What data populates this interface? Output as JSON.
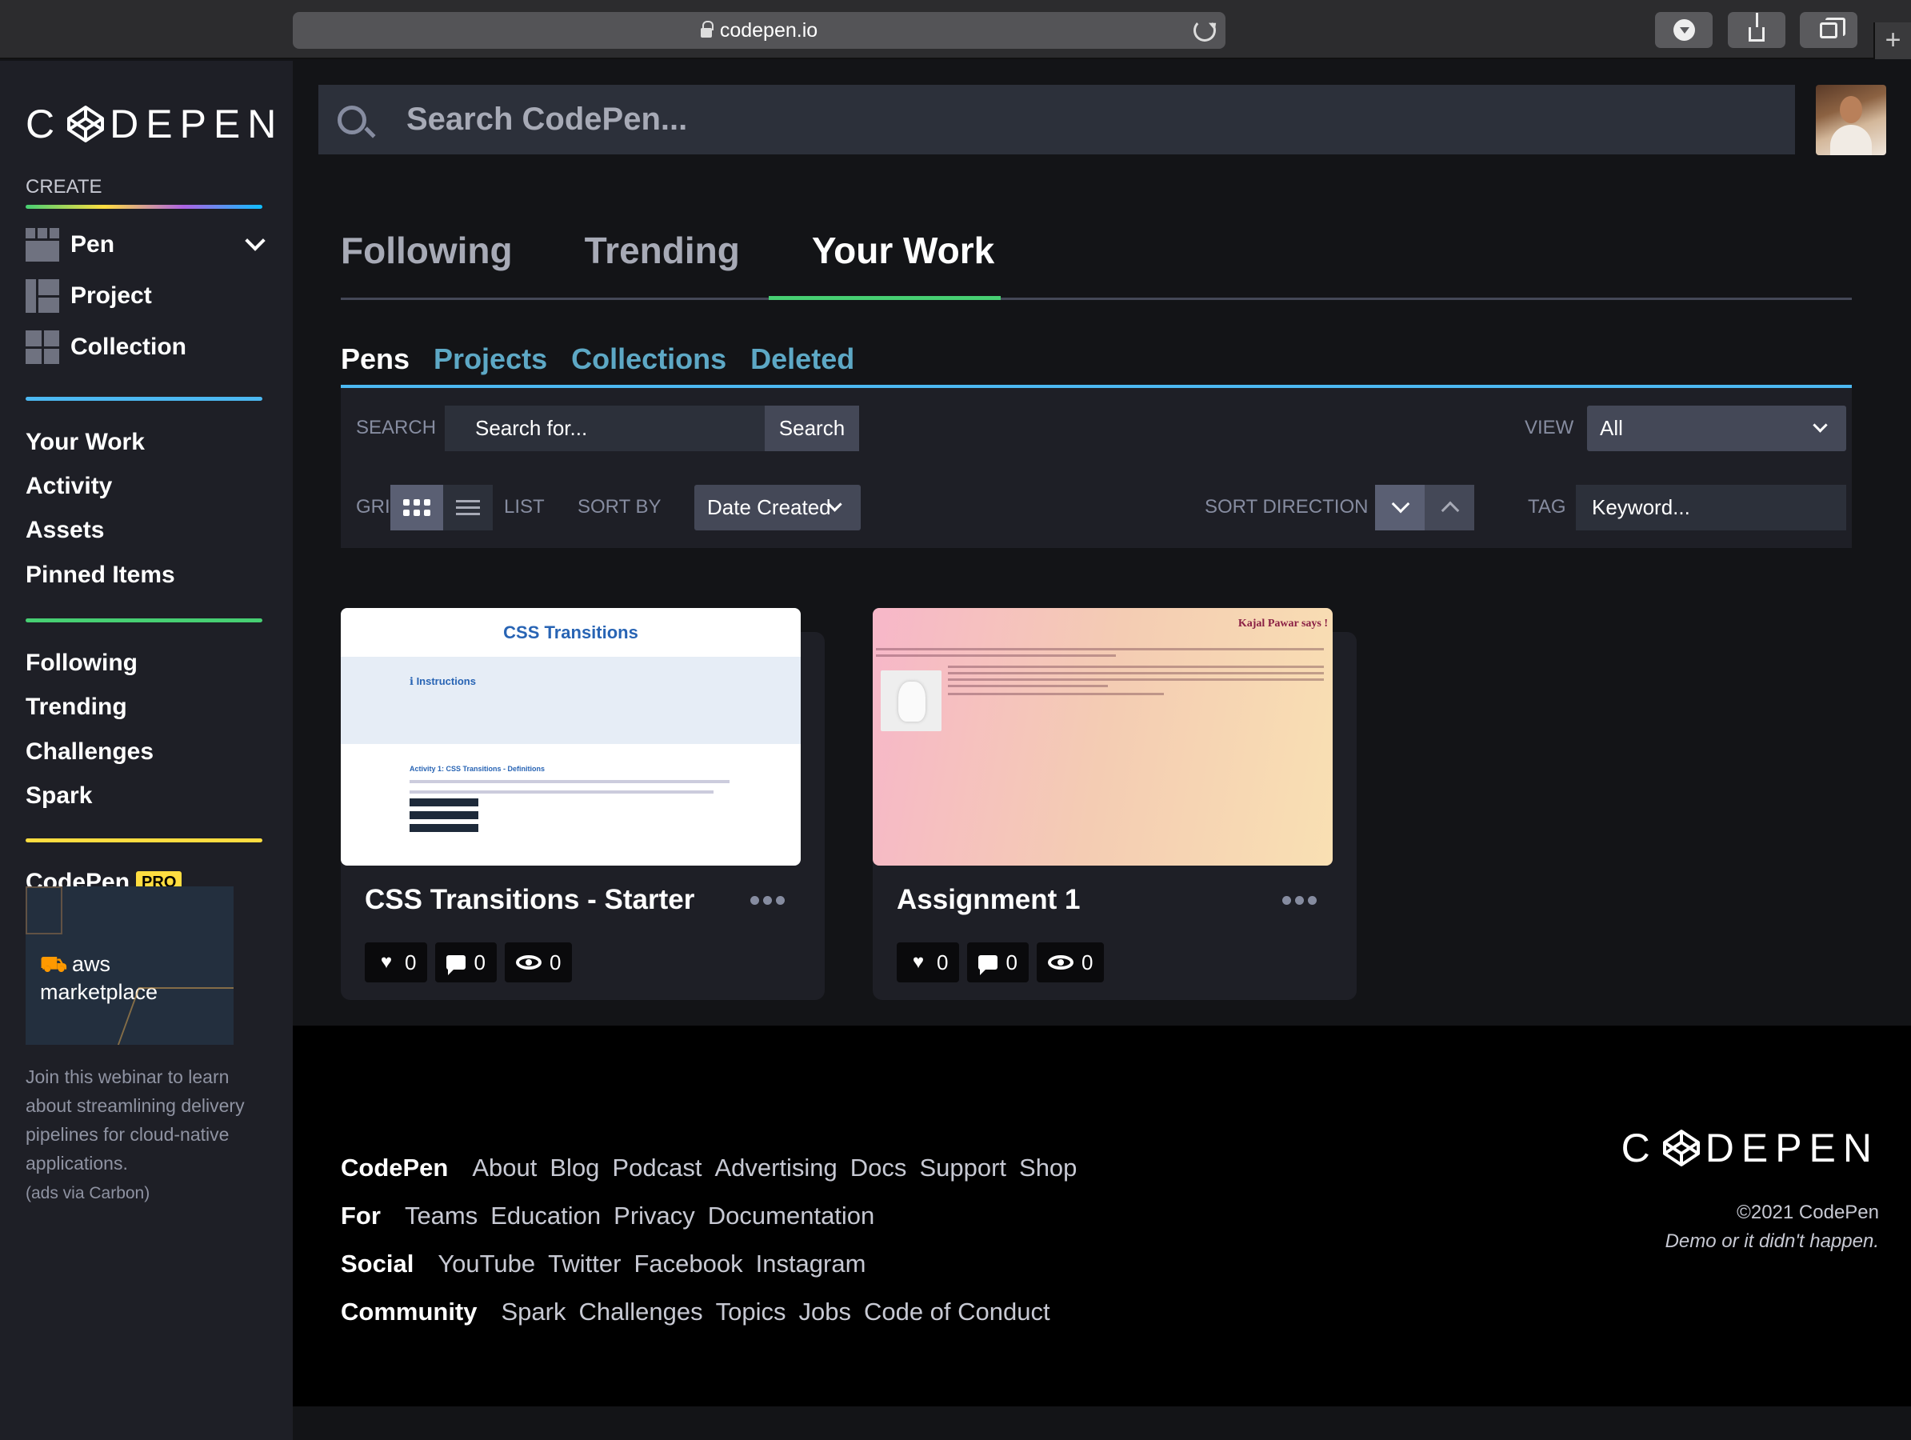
{
  "browser": {
    "url": "codepen.io"
  },
  "sidebar": {
    "logo": "CODEPEN",
    "create_label": "CREATE",
    "create_items": [
      {
        "label": "Pen"
      },
      {
        "label": "Project"
      },
      {
        "label": "Collection"
      }
    ],
    "nav_group1": [
      "Your Work",
      "Activity",
      "Assets",
      "Pinned Items"
    ],
    "nav_group2": [
      "Following",
      "Trending",
      "Challenges",
      "Spark"
    ],
    "pro_label": "CodePen",
    "pro_badge": "PRO",
    "ad": {
      "brand": "aws marketplace",
      "text": "Join this webinar to learn about streamlining delivery pipelines for cloud-native applications.",
      "via": "(ads via Carbon)"
    }
  },
  "header": {
    "search_placeholder": "Search CodePen..."
  },
  "tabs": [
    "Following",
    "Trending",
    "Your Work"
  ],
  "active_tab": "Your Work",
  "sub_tabs": [
    "Pens",
    "Projects",
    "Collections",
    "Deleted"
  ],
  "active_sub_tab": "Pens",
  "filters": {
    "search_label": "SEARCH",
    "search_placeholder": "Search for...",
    "search_button": "Search",
    "view_label": "VIEW",
    "view_value": "All",
    "grid_label": "GRID",
    "list_label": "LIST",
    "sort_by_label": "SORT BY",
    "sort_by_value": "Date Created",
    "sort_direction_label": "SORT DIRECTION",
    "tag_label": "TAG",
    "tag_placeholder": "Keyword..."
  },
  "pens": [
    {
      "title": "CSS Transitions - Starter",
      "likes": "0",
      "comments": "0",
      "views": "0",
      "thumb": {
        "heading": "CSS Transitions",
        "instructions": "Instructions",
        "activity": "Activity 1: CSS Transitions - Definitions"
      }
    },
    {
      "title": "Assignment 1",
      "likes": "0",
      "comments": "0",
      "views": "0",
      "thumb": {
        "heading": "Kajal Pawar says !"
      }
    }
  ],
  "footer": {
    "rows": [
      {
        "head": "CodePen",
        "links": [
          "About",
          "Blog",
          "Podcast",
          "Advertising",
          "Docs",
          "Support",
          "Shop"
        ]
      },
      {
        "head": "For",
        "links": [
          "Teams",
          "Education",
          "Privacy",
          "Documentation"
        ]
      },
      {
        "head": "Social",
        "links": [
          "YouTube",
          "Twitter",
          "Facebook",
          "Instagram"
        ]
      },
      {
        "head": "Community",
        "links": [
          "Spark",
          "Challenges",
          "Topics",
          "Jobs",
          "Code of Conduct"
        ]
      }
    ],
    "logo": "CODEPEN",
    "copyright": "©2021 CodePen",
    "tagline": "Demo or it didn't happen."
  },
  "colors": {
    "green": "#47cf73",
    "blue": "#4cb8f1",
    "yellow": "#ffdd40",
    "sidebar_bg": "#1e1f26",
    "page_bg": "#131417"
  }
}
